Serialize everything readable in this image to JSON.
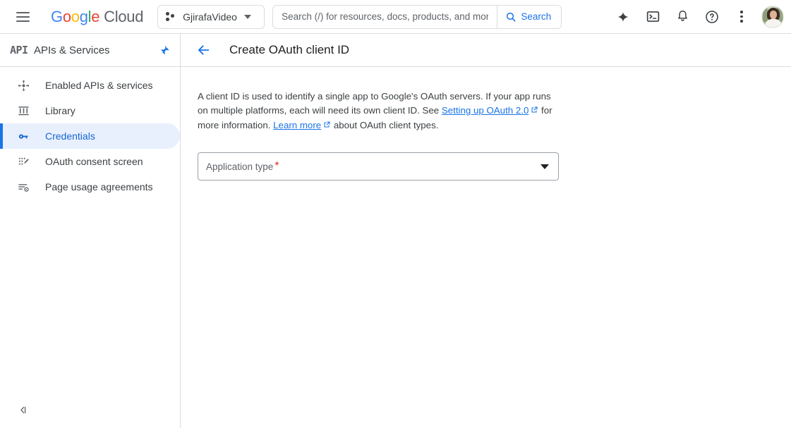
{
  "topbar": {
    "menu_icon": "hamburger-menu-icon",
    "logo": {
      "g1": "G",
      "o1": "o",
      "o2": "o",
      "g2": "g",
      "l1": "l",
      "e1": "e",
      "cloud": "Cloud"
    },
    "project": {
      "name": "GjirafaVideo",
      "icon": "project-dots-icon",
      "caret": "chevron-down-icon"
    },
    "search": {
      "placeholder": "Search (/) for resources, docs, products, and more",
      "value": "",
      "button_label": "Search",
      "icon": "search-icon"
    },
    "icons": [
      {
        "name": "gemini-sparkle-icon"
      },
      {
        "name": "cloud-shell-terminal-icon"
      },
      {
        "name": "notifications-bell-icon"
      },
      {
        "name": "help-circle-icon"
      },
      {
        "name": "more-vert-icon"
      }
    ],
    "avatar": {
      "name": "user-avatar"
    }
  },
  "sidebar": {
    "logo_text": "API",
    "title": "APIs & Services",
    "pin_icon": "pin-icon",
    "pin_color": "#1a73e8",
    "active_bg": "#e8f0fe",
    "active_color": "#1967d2",
    "items": [
      {
        "label": "Enabled APIs & services",
        "icon": "enabled-apis-icon",
        "active": false
      },
      {
        "label": "Library",
        "icon": "library-icon",
        "active": false
      },
      {
        "label": "Credentials",
        "icon": "key-icon",
        "active": true
      },
      {
        "label": "OAuth consent screen",
        "icon": "oauth-consent-icon",
        "active": false
      },
      {
        "label": "Page usage agreements",
        "icon": "page-usage-agreements-icon",
        "active": false
      }
    ],
    "collapse_icon": "collapse-panel-icon"
  },
  "page": {
    "back_icon": "back-arrow-icon",
    "title": "Create OAuth client ID",
    "description": {
      "part1": "A client ID is used to identify a single app to Google's OAuth servers. If your app runs on multiple platforms, each will need its own client ID. See ",
      "link1": "Setting up OAuth 2.0",
      "part2": " for more information. ",
      "link2": "Learn more",
      "part3": " about OAuth client types.",
      "external_icon": "external-link-icon"
    },
    "form": {
      "application_type": {
        "label": "Application type",
        "required_marker": "*",
        "value": "",
        "caret_icon": "dropdown-caret-icon"
      }
    }
  }
}
